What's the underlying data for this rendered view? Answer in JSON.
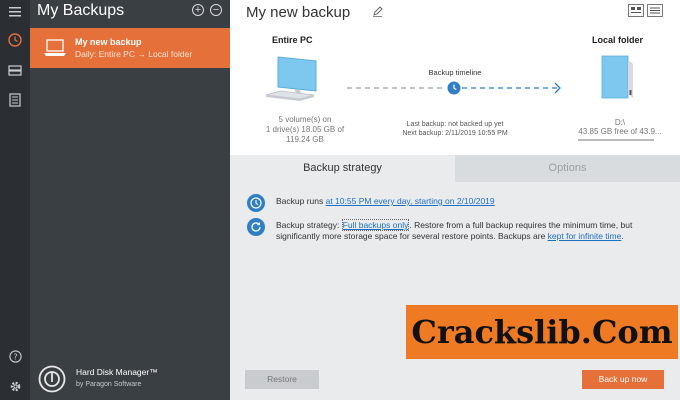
{
  "sidebar": {
    "title": "My Backups",
    "add_icon": "plus-circle-icon",
    "remove_icon": "minus-circle-icon",
    "items": [
      {
        "name": "My new backup",
        "schedule": "Daily: Entire PC → Local folder"
      }
    ],
    "brand": {
      "name": "Hard Disk Manager™",
      "sub": "by Paragon Software"
    }
  },
  "rail": {
    "icons": [
      "hamburger-icon",
      "clock-icon",
      "drive-icon",
      "log-icon",
      "help-icon",
      "gear-icon"
    ]
  },
  "main": {
    "title": "My new backup",
    "source": {
      "label": "Entire PC",
      "info_line1": "5 volume(s) on",
      "info_line2": "1 drive(s) 18.05 GB of",
      "info_line3": "119.24 GB"
    },
    "timeline": {
      "label": "Backup timeline",
      "last": "Last backup: not backed up yet",
      "next": "Next backup: 2/11/2019 10:55 PM"
    },
    "destination": {
      "label": "Local folder",
      "path": "D:\\",
      "free": "43.85 GB free of 43.9..."
    },
    "tabs": [
      {
        "label": "Backup strategy",
        "active": true
      },
      {
        "label": "Options",
        "active": false
      }
    ],
    "strategy": {
      "runs_prefix": "Backup runs ",
      "runs_link": "at 10:55 PM every day, starting on 2/10/2019",
      "strategy_prefix": "Backup strategy: ",
      "strategy_link": "Full backups only",
      "strategy_mid": ". Restore from a full backup requires the minimum time, but significantly more storage space for several restore points. Backups are ",
      "kept_link": "kept for infinite time",
      "strategy_end": "."
    },
    "buttons": {
      "restore": "Restore",
      "backup_now": "Back up now"
    }
  },
  "watermark": "Crackslib.Com",
  "colors": {
    "accent": "#e6703a",
    "sidebar": "#3a3f44",
    "rail": "#2b2f33",
    "link": "#1f6fc0",
    "icon_blue": "#2f7fc5"
  }
}
